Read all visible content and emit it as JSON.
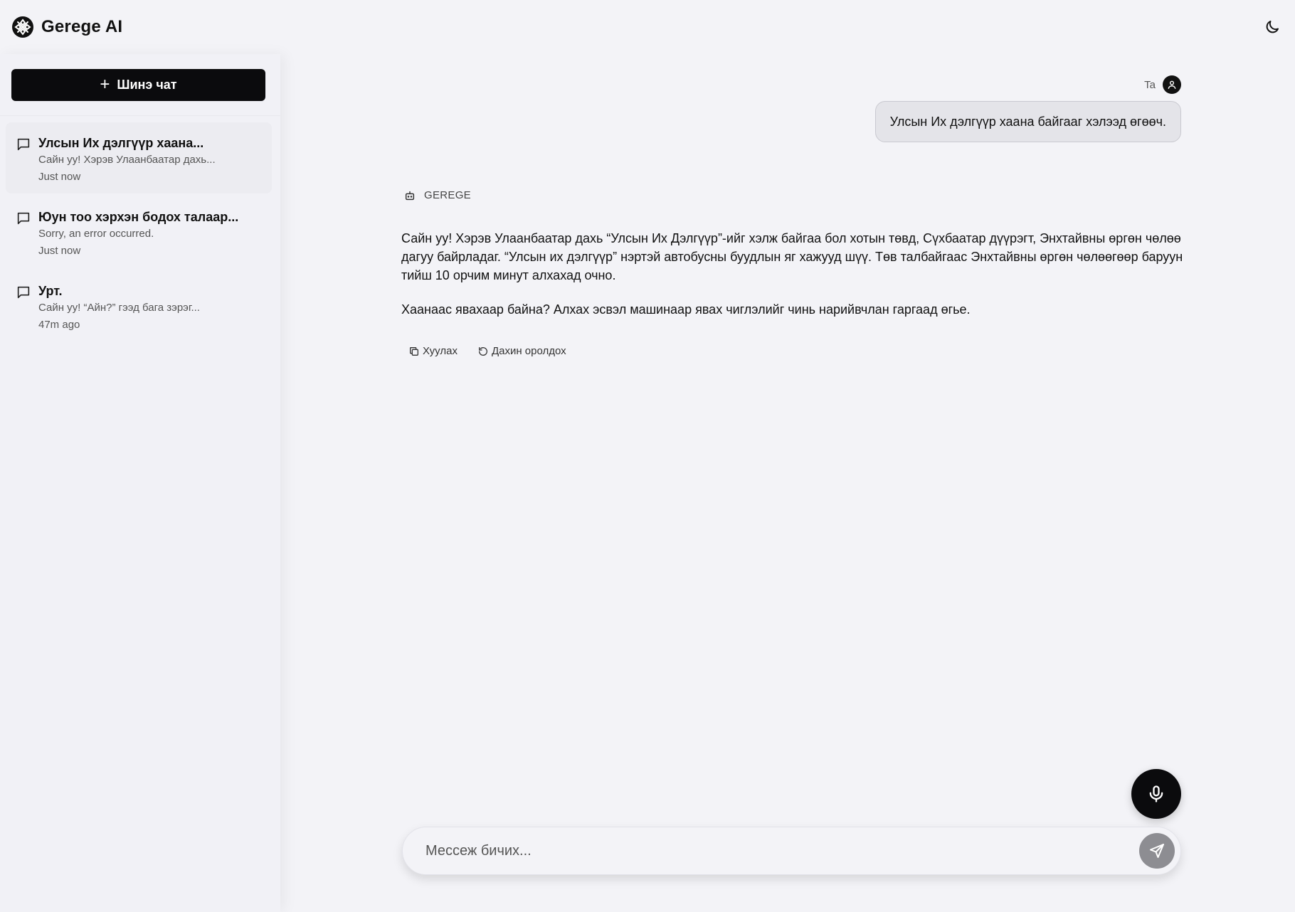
{
  "app": {
    "name": "Gerege AI"
  },
  "sidebar": {
    "new_chat_label": "Шинэ чат",
    "conversations": [
      {
        "title": "Улсын Их дэлгүүр хаана...",
        "preview": "Сайн уу! Хэрэв Улаанбаатар дахь...",
        "time": "Just now",
        "active": true
      },
      {
        "title": "Юун тоо хэрхэн бодох талаар...",
        "preview": "Sorry, an error occurred.",
        "time": "Just now",
        "active": false
      },
      {
        "title": "Урт.",
        "preview": "Сайн уу! “Айн?” гээд бага зэрэг...",
        "time": "47m ago",
        "active": false
      }
    ]
  },
  "chat": {
    "user_label": "Ta",
    "user_message": "Улсын Их дэлгүүр хаана байгааг хэлээд өгөөч.",
    "bot_label": "GEREGE",
    "bot_paragraphs": [
      "Сайн уу! Хэрэв Улаанбаатар дахь “Улсын Их Дэлгүүр”-ийг хэлж байгаа бол хотын төвд, Сүхбаатар дүүрэгт, Энхтайвны өргөн чөлөө дагуу байрладаг. “Улсын их дэлгүүр” нэртэй автобусны буудлын яг хажууд шүү. Төв талбайгаас Энхтайвны өргөн чөлөөгөөр баруун тийш 10 орчим минут алхахад очно.",
      "Хаанаас явахаар байна? Алхах эсвэл машинаар явах чиглэлийг чинь нарийвчлан гаргаад өгье."
    ],
    "actions": {
      "copy_label": "Хуулах",
      "retry_label": "Дахин оролдох"
    }
  },
  "composer": {
    "placeholder": "Мессеж бичих...",
    "value": ""
  },
  "icons": {
    "logo": "gerege-logo-icon",
    "theme": "moon-icon",
    "new_chat": "plus-icon",
    "conversation": "chat-bubble-icon",
    "user": "user-icon",
    "bot": "bot-icon",
    "copy": "copy-icon",
    "retry": "refresh-icon",
    "mic": "microphone-icon",
    "send": "send-icon"
  },
  "colors": {
    "background": "#f3f3f7",
    "sidebar": "#f1f1f6",
    "primary": "#0b0b0d",
    "user_bubble": "#e4e4e9",
    "send_button": "#8d8d92"
  }
}
